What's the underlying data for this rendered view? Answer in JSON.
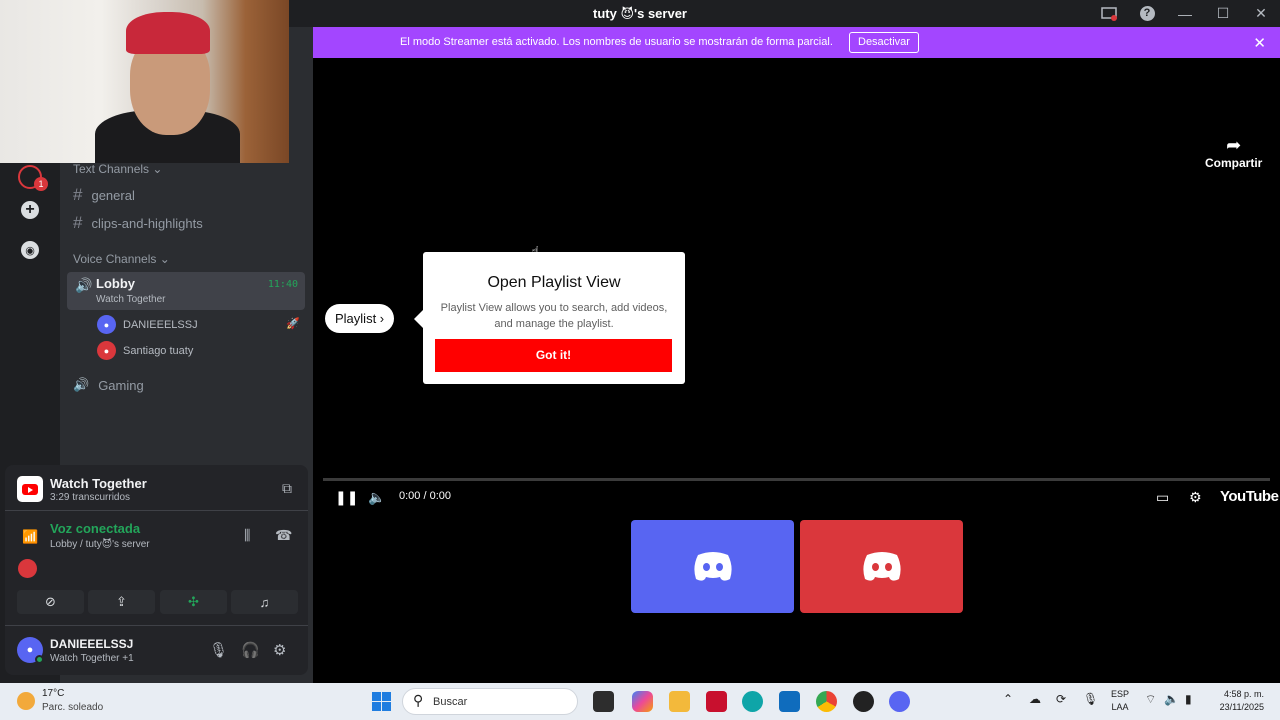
{
  "window": {
    "title": "tuty 😈's server",
    "icons": [
      "inbox-icon",
      "help-icon",
      "minimize-icon",
      "maximize-icon",
      "close-icon"
    ],
    "symbols": {
      "help": "?",
      "minimize": "—",
      "maximize": "☐",
      "close": "✕"
    }
  },
  "streamer_bar": {
    "message": "El modo Streamer está activado. Los nombres de usuario se mostrarán de forma parcial.",
    "button": "Desactivar",
    "close": "✕",
    "color": "#a346ff"
  },
  "rail": {
    "badge": "1",
    "add": "+",
    "explore": "◉"
  },
  "channels": {
    "text_category": "Text Channels",
    "text": [
      {
        "name": "general"
      },
      {
        "name": "clips-and-highlights"
      }
    ],
    "voice_category": "Voice Channels",
    "lobby": {
      "name": "Lobby",
      "activity": "Watch Together",
      "time": "11:40"
    },
    "voice_users": [
      {
        "name": "DANIEEELSSJ",
        "color": "#5865f2"
      },
      {
        "name": "Santiago tuaty",
        "color": "#da373c"
      }
    ],
    "gaming": "Gaming",
    "hash": "#",
    "speaker": "🔊"
  },
  "activity": {
    "title": "Watch Together",
    "subtitle": "3:29 transcurridos"
  },
  "voice": {
    "status": "Voz conectada",
    "location": "Lobby / tuty😈's server"
  },
  "user": {
    "name": "DANIEEELSSJ",
    "status": "Watch Together +1"
  },
  "video": {
    "share": "Compartir",
    "share_arrow": "➦",
    "playlist_pill": "Playlist ›",
    "popup": {
      "title": "Open Playlist View",
      "desc": "Playlist View allows you to search, add videos, and manage the playlist.",
      "button": "Got it!"
    },
    "time": "0:00 / 0:00",
    "logo": "YouTube",
    "pause": "❚❚",
    "volume": "🔈",
    "settings": "⚙",
    "tiles": [
      {
        "color": "#5865f2"
      },
      {
        "color": "#da373c"
      }
    ]
  },
  "taskbar": {
    "weather_temp": "17°C",
    "weather_desc": "Parc. soleado",
    "search": "Buscar",
    "lang_top": "ESP",
    "lang_bottom": "LAA",
    "time": "4:58 p. m.",
    "date": "23/11/2025",
    "search_icon": "⚲",
    "chevron": "⌃"
  }
}
